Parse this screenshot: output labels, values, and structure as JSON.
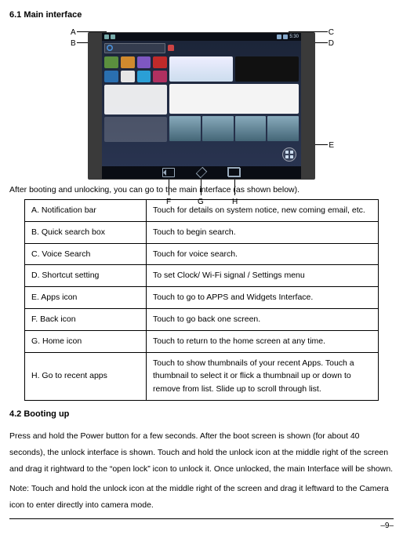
{
  "sections": {
    "main_interface_heading": "6.1 Main interface",
    "booting_heading": "4.2 Booting up"
  },
  "callouts": {
    "A": "A",
    "B": "B",
    "C": "C",
    "D": "D",
    "E": "E",
    "F": "F",
    "G": "G",
    "H": "H"
  },
  "intro": "After booting and unlocking, you can go to the main interface (as shown below).",
  "table": {
    "rows": [
      {
        "label": "A. Notification bar",
        "desc": "Touch for details on system notice, new coming email, etc."
      },
      {
        "label": "B. Quick search box",
        "desc": "Touch to begin search."
      },
      {
        "label": "C. Voice Search",
        "desc": "Touch for voice search."
      },
      {
        "label": "D. Shortcut setting",
        "desc": "To set Clock/ Wi-Fi signal / Settings menu"
      },
      {
        "label": "E. Apps icon",
        "desc": "Touch to go to APPS and Widgets Interface."
      },
      {
        "label": "F. Back  icon",
        "desc": "Touch to go back one screen."
      },
      {
        "label": "G. Home icon",
        "desc": "Touch to return to the home screen at any time."
      },
      {
        "label": "H. Go to recent apps",
        "desc": "Touch to show thumbnails of your recent Apps. Touch a thumbnail to select it or flick a thumbnail up or down to remove from list. Slide up to scroll through list."
      }
    ]
  },
  "booting": {
    "p1": "Press and hold the Power button for a few seconds. After the boot screen is shown (for about 40 seconds), the unlock interface is shown. Touch and hold the unlock icon at the middle right of the screen and drag it rightward to the “open lock” icon to unlock it. Once unlocked, the main Interface will be shown.",
    "p2": "Note: Touch and hold the unlock icon at the middle right of the screen and drag it leftward to the Camera icon to enter directly into camera mode."
  },
  "page_number": "–9–",
  "screenshot": {
    "status_time": "5:30"
  }
}
